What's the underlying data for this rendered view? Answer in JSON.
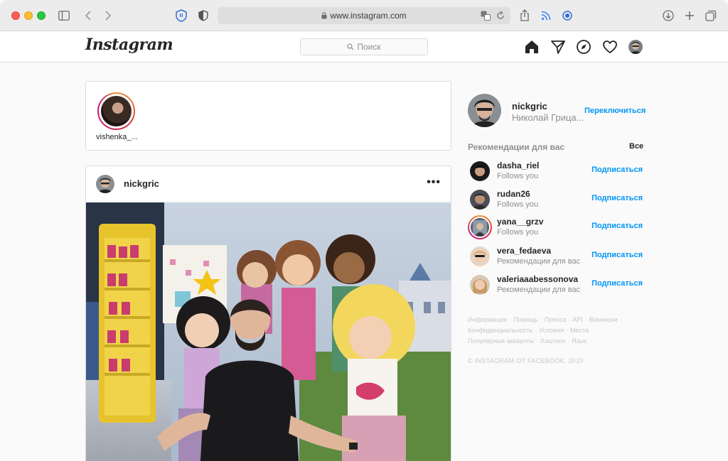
{
  "browser": {
    "url": "www.instagram.com"
  },
  "header": {
    "logo": "Instagram",
    "search_placeholder": "Поиск"
  },
  "stories": [
    {
      "username": "vishenka_..."
    }
  ],
  "post": {
    "username": "nickgric",
    "more": "•••"
  },
  "sidebar": {
    "username": "nickgric",
    "full_name": "Николай Грица...",
    "switch_label": "Переключиться",
    "recommendations_title": "Рекомендации для вас",
    "see_all": "Все",
    "recommendations": [
      {
        "username": "dasha_riel",
        "subtitle": "Follows you",
        "action": "Подписаться"
      },
      {
        "username": "rudan26",
        "subtitle": "Follows you",
        "action": "Подписаться"
      },
      {
        "username": "yana__grzv",
        "subtitle": "Follows you",
        "action": "Подписаться"
      },
      {
        "username": "vera_fedaeva",
        "subtitle": "Рекомендации для вас",
        "action": "Подписаться"
      },
      {
        "username": "valeriaaabessonova",
        "subtitle": "Рекомендации для вас",
        "action": "Подписаться"
      }
    ],
    "footer_links": [
      "Информация",
      "Помощь",
      "Пресса",
      "API",
      "Вакансии",
      "Конфиденциальность",
      "Условия",
      "Места",
      "Популярные аккаунты",
      "Хэштеги",
      "Язык"
    ],
    "copyright": "© INSTAGRAM ОТ FACEBOOK, 2020"
  },
  "colors": {
    "accent": "#0095f6",
    "border": "#dbdbdb",
    "background": "#fafafa"
  }
}
